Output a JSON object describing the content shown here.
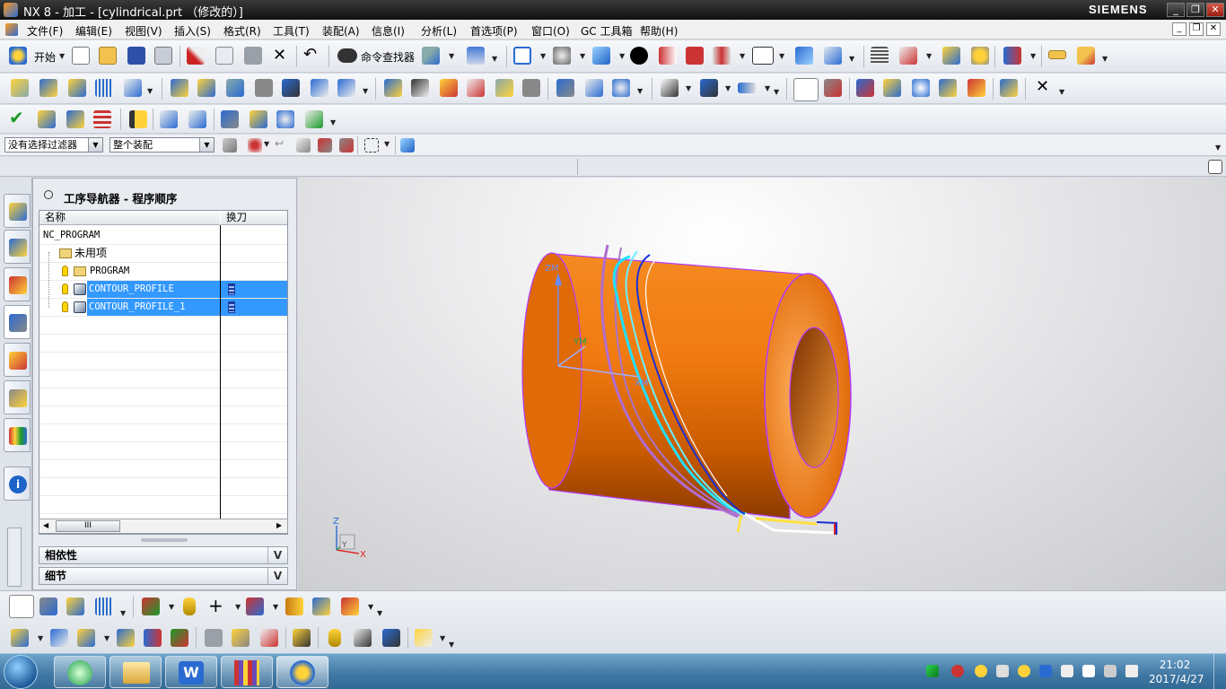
{
  "window": {
    "title": "NX 8 - 加工 - [cylindrical.prt （修改的）]",
    "brand": "SIEMENS"
  },
  "menubar": {
    "items": [
      "文件(F)",
      "编辑(E)",
      "视图(V)",
      "插入(S)",
      "格式(R)",
      "工具(T)",
      "装配(A)",
      "信息(I)",
      "分析(L)",
      "首选项(P)",
      "窗口(O)",
      "GC 工具箱",
      "帮助(H)"
    ]
  },
  "toolbar": {
    "start_label": "开始",
    "command_finder_label": "命令查找器"
  },
  "filterbar": {
    "type_filter": "没有选择过滤器",
    "scope_filter": "整个装配"
  },
  "navigator": {
    "title": "工序导航器 - 程序顺序",
    "columns": [
      "名称",
      "换刀"
    ],
    "rows": [
      {
        "name": "NC_PROGRAM",
        "selected": false
      },
      {
        "name": "未用项",
        "selected": false
      },
      {
        "name": "PROGRAM",
        "selected": false
      },
      {
        "name": "CONTOUR_PROFILE",
        "selected": true
      },
      {
        "name": "CONTOUR_PROFILE_1",
        "selected": true
      }
    ],
    "scroll_label": "III",
    "panels": [
      "相依性",
      "细节"
    ]
  },
  "viewport": {
    "wcs_labels": {
      "z": "ZM",
      "y": "YM",
      "x": "XM"
    },
    "triad": {
      "z": "Z",
      "y": "Y",
      "x": "X"
    }
  },
  "taskbar": {
    "time": "21:02",
    "date": "2017/4/27"
  },
  "colors": {
    "part": "#f07a10",
    "selection": "#3399ff",
    "toolpath": "#22e0ff"
  }
}
